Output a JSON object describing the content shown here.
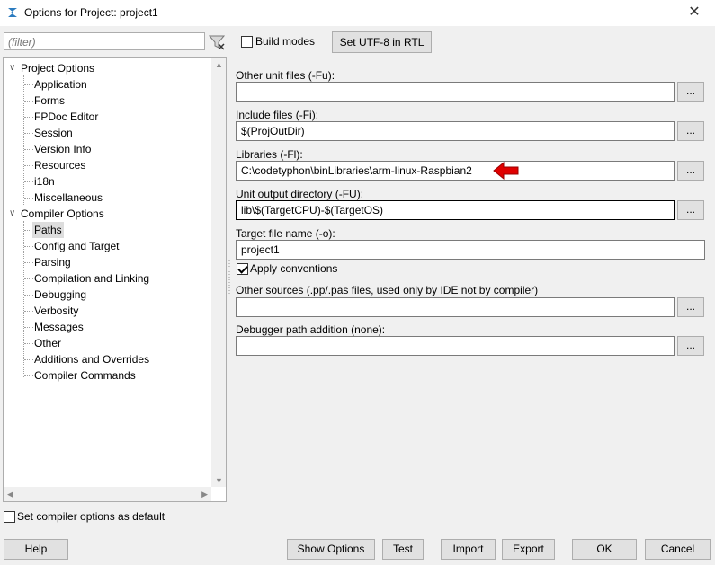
{
  "window": {
    "title": "Options for Project: project1",
    "close_glyph": "✕"
  },
  "filter": {
    "placeholder": "(filter)"
  },
  "tree": {
    "groups": [
      {
        "label": "Project Options",
        "expanded": true,
        "items": [
          "Application",
          "Forms",
          "FPDoc Editor",
          "Session",
          "Version Info",
          "Resources",
          "i18n",
          "Miscellaneous"
        ]
      },
      {
        "label": "Compiler Options",
        "expanded": true,
        "items": [
          "Paths",
          "Config and Target",
          "Parsing",
          "Compilation and Linking",
          "Debugging",
          "Verbosity",
          "Messages",
          "Other",
          "Additions and Overrides",
          "Compiler Commands"
        ]
      }
    ],
    "selected": "Paths",
    "collapse_glyph": "∨"
  },
  "toolbar": {
    "build_modes_label": "Build modes",
    "build_modes_checked": false,
    "set_utf8_label": "Set UTF-8 in RTL"
  },
  "paths": {
    "other_unit_files_label": "Other unit files (-Fu):",
    "other_unit_files_value": "",
    "include_files_label": "Include files (-Fi):",
    "include_files_value": "$(ProjOutDir)",
    "libraries_label": "Libraries (-Fl):",
    "libraries_value": "C:\\codetyphon\\binLibraries\\arm-linux-Raspbian2",
    "unit_output_label": "Unit output directory (-FU):",
    "unit_output_value": "lib\\$(TargetCPU)-$(TargetOS)",
    "target_file_label": "Target file name (-o):",
    "target_file_value": "project1",
    "apply_conventions_label": "Apply conventions",
    "apply_conventions_checked": true,
    "other_sources_label": "Other sources (.pp/.pas files, used only by IDE not by compiler)",
    "other_sources_value": "",
    "debugger_path_label": "Debugger path addition (none):",
    "debugger_path_value": "",
    "browse_label": "..."
  },
  "footer": {
    "set_default_label": "Set compiler options as default",
    "set_default_checked": false,
    "help_label": "Help",
    "show_options_label": "Show Options",
    "test_label": "Test",
    "import_label": "Import",
    "export_label": "Export",
    "ok_label": "OK",
    "cancel_label": "Cancel"
  },
  "colors": {
    "annotation_arrow": "#e00000",
    "focus_border": "#0078d7",
    "title_icon": "#2b7bbf"
  }
}
